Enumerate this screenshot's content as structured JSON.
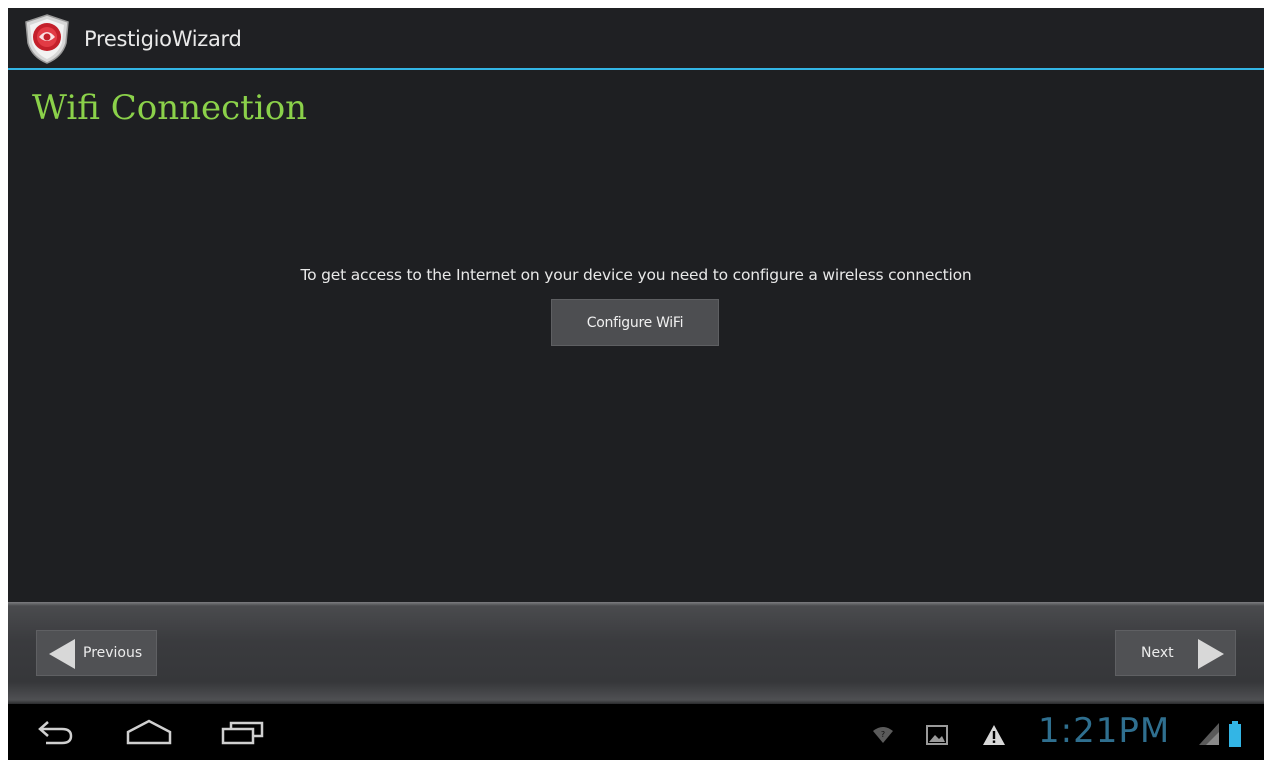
{
  "app": {
    "title": "PrestigioWizard",
    "icon": "prestigio-shield-logo"
  },
  "page": {
    "heading": "Wifi Connection",
    "message": "To get access to the Internet on your device you need to configure a wireless connection",
    "configure_button": "Configure WiFi"
  },
  "wizard_nav": {
    "previous_label": "Previous",
    "next_label": "Next"
  },
  "system_bar": {
    "back_icon": "back-icon",
    "home_icon": "home-icon",
    "recents_icon": "recent-apps-icon",
    "notifications": [
      "wifi-notification-icon",
      "gallery-notification-icon",
      "warning-notification-icon"
    ],
    "clock": "1:21PM"
  },
  "colors": {
    "accent": "#33b5e5",
    "heading": "#8bd14a",
    "clock": "#2f6f8f",
    "battery": "#33b5e5"
  }
}
